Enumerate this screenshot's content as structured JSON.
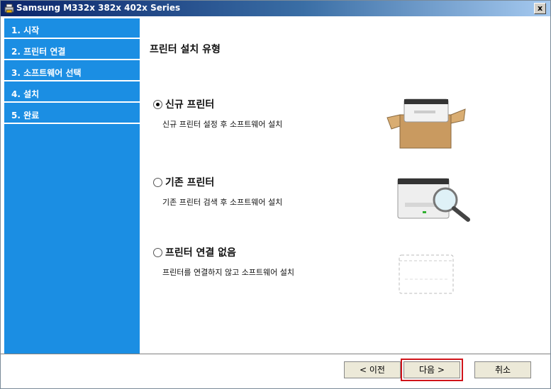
{
  "window": {
    "title": "Samsung M332x 382x 402x Series",
    "close_glyph": "x"
  },
  "sidebar": {
    "steps": [
      {
        "label": "1. 시작"
      },
      {
        "label": "2. 프린터 연결"
      },
      {
        "label": "3. 소프트웨어 선택"
      },
      {
        "label": "4. 설치"
      },
      {
        "label": "5. 완료"
      }
    ]
  },
  "main": {
    "heading": "프린터 설치 유형",
    "options": [
      {
        "title": "신규 프린터",
        "desc": "신규 프린터 설정 후 소프트웨어 설치",
        "checked": true
      },
      {
        "title": "기존 프린터",
        "desc": "기존 프린터 검색 후 소프트웨어 설치",
        "checked": false
      },
      {
        "title": "프린터 연결 없음",
        "desc": "프린터를 연결하지 않고 소프트웨어 설치",
        "checked": false
      }
    ]
  },
  "footer": {
    "back_label": "< 이전",
    "next_label": "다음 >",
    "cancel_label": "취소"
  },
  "colors": {
    "sidebar": "#1b8ee3",
    "highlight": "#d0141a"
  }
}
